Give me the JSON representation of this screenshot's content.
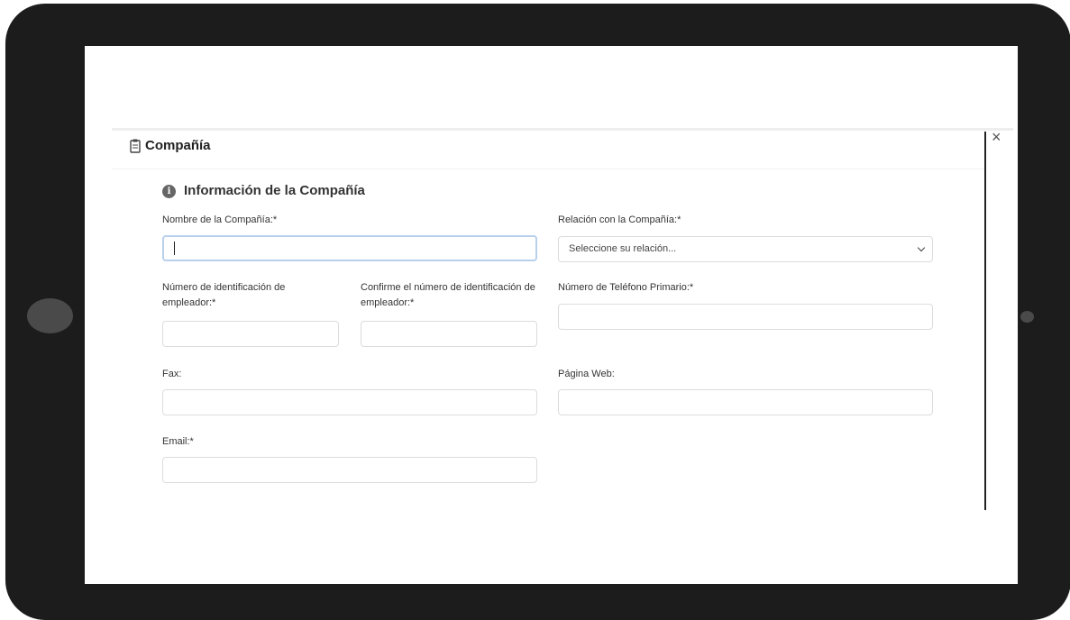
{
  "modal": {
    "title": "Compañía",
    "close_glyph": "×",
    "section_title": "Información de la Compañía",
    "info_glyph": "i"
  },
  "fields": {
    "company_name": {
      "label": "Nombre de la Compañía:*",
      "value": ""
    },
    "relation": {
      "label": "Relación con la Compañía:*",
      "selected": "Seleccione su relación..."
    },
    "ein": {
      "label": "Número de identificación de empleador:*",
      "value": ""
    },
    "ein_confirm": {
      "label": "Confirme el número de identificación de empleador:*",
      "value": ""
    },
    "phone": {
      "label": "Número de Teléfono Primario:*",
      "value": ""
    },
    "fax": {
      "label": "Fax:",
      "value": ""
    },
    "website": {
      "label": "Página Web:",
      "value": ""
    },
    "email": {
      "label": "Email:*",
      "value": ""
    }
  },
  "icons": [
    "clipboard-icon",
    "info-icon",
    "close-icon",
    "chevron-down-icon"
  ]
}
